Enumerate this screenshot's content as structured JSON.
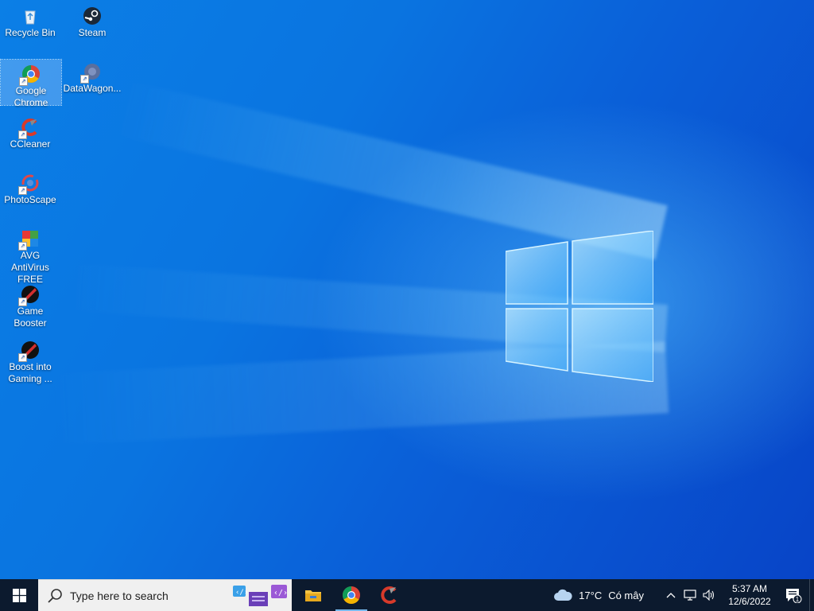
{
  "desktop": {
    "icons": [
      {
        "label": "Recycle Bin",
        "icon": "recycle-bin-icon"
      },
      {
        "label": "Steam",
        "icon": "steam-icon"
      },
      {
        "label": "Google Chrome",
        "icon": "chrome-icon",
        "selected": true
      },
      {
        "label": "DataWagon...",
        "icon": "datawagon-icon"
      },
      {
        "label": "CCleaner",
        "icon": "ccleaner-icon"
      },
      {
        "label": "PhotoScape",
        "icon": "photoscape-icon"
      },
      {
        "label": "AVG AntiVirus FREE",
        "icon": "avg-icon"
      },
      {
        "label": "Game Booster",
        "icon": "game-booster-icon"
      },
      {
        "label": "Boost into Gaming ...",
        "icon": "boost-gaming-icon"
      }
    ]
  },
  "taskbar": {
    "search_placeholder": "Type here to search",
    "apps": [
      {
        "name": "file-explorer",
        "icon": "folder-icon"
      },
      {
        "name": "google-chrome",
        "icon": "chrome-icon",
        "active": true
      },
      {
        "name": "ccleaner",
        "icon": "ccleaner-icon"
      }
    ],
    "weather": {
      "temp": "17°C",
      "condition": "Có mây"
    },
    "clock": {
      "time": "5:37 AM",
      "date": "12/6/2022"
    },
    "notifications_count": "1"
  },
  "colors": {
    "taskbar_bg": "#0c1a2e",
    "accent": "#76b9ed",
    "wallpaper_blue": "#0a74e0"
  }
}
